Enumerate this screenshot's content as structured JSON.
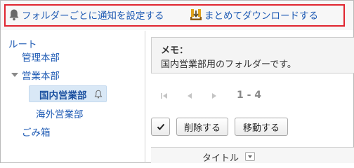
{
  "toolbar": {
    "notify_label": "フォルダーごとに通知を設定する",
    "download_label": "まとめてダウンロードする"
  },
  "tree": {
    "root": "ルート",
    "management": "管理本部",
    "sales": "営業本部",
    "domestic_sales": "国内営業部",
    "overseas_sales": "海外営業部",
    "trash": "ごみ箱"
  },
  "memo": {
    "title": "メモ：",
    "text": "国内営業部用のフォルダーです。"
  },
  "pager": {
    "range": "1 - 4"
  },
  "actions": {
    "delete_label": "削除する",
    "move_label": "移動する"
  },
  "table": {
    "columns": [
      "タイトル"
    ]
  },
  "colors": {
    "link": "#1f5bb4",
    "highlight_border": "#e0252f",
    "selected_bg": "#d9e8f6"
  }
}
